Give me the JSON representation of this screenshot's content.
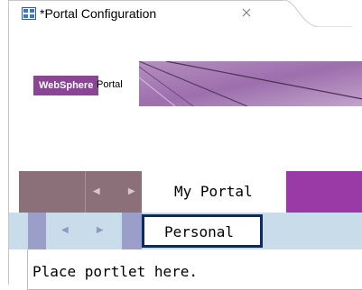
{
  "editor_tab": {
    "title": "*Portal Configuration",
    "icon": "portal-configuration-icon",
    "close_icon": "close-icon"
  },
  "banner": {
    "logo_brand": "WebSphere",
    "logo_product": "Portal"
  },
  "nav_level1": {
    "arrows": "◀ ▶",
    "selected_page": "My Portal"
  },
  "nav_level2": {
    "arrows": "◀ ▶",
    "selected_page": "Personal"
  },
  "content": {
    "placeholder": "Place portlet here."
  },
  "colors": {
    "nav1_inactive": "#8c7079",
    "nav1_accent": "#9a3aa6",
    "nav2_bg": "#c8dde9",
    "nav2_inactive": "#9b9ec8",
    "nav2_selected_border": "#0d2a5e",
    "logo_bg": "#8a4595"
  }
}
